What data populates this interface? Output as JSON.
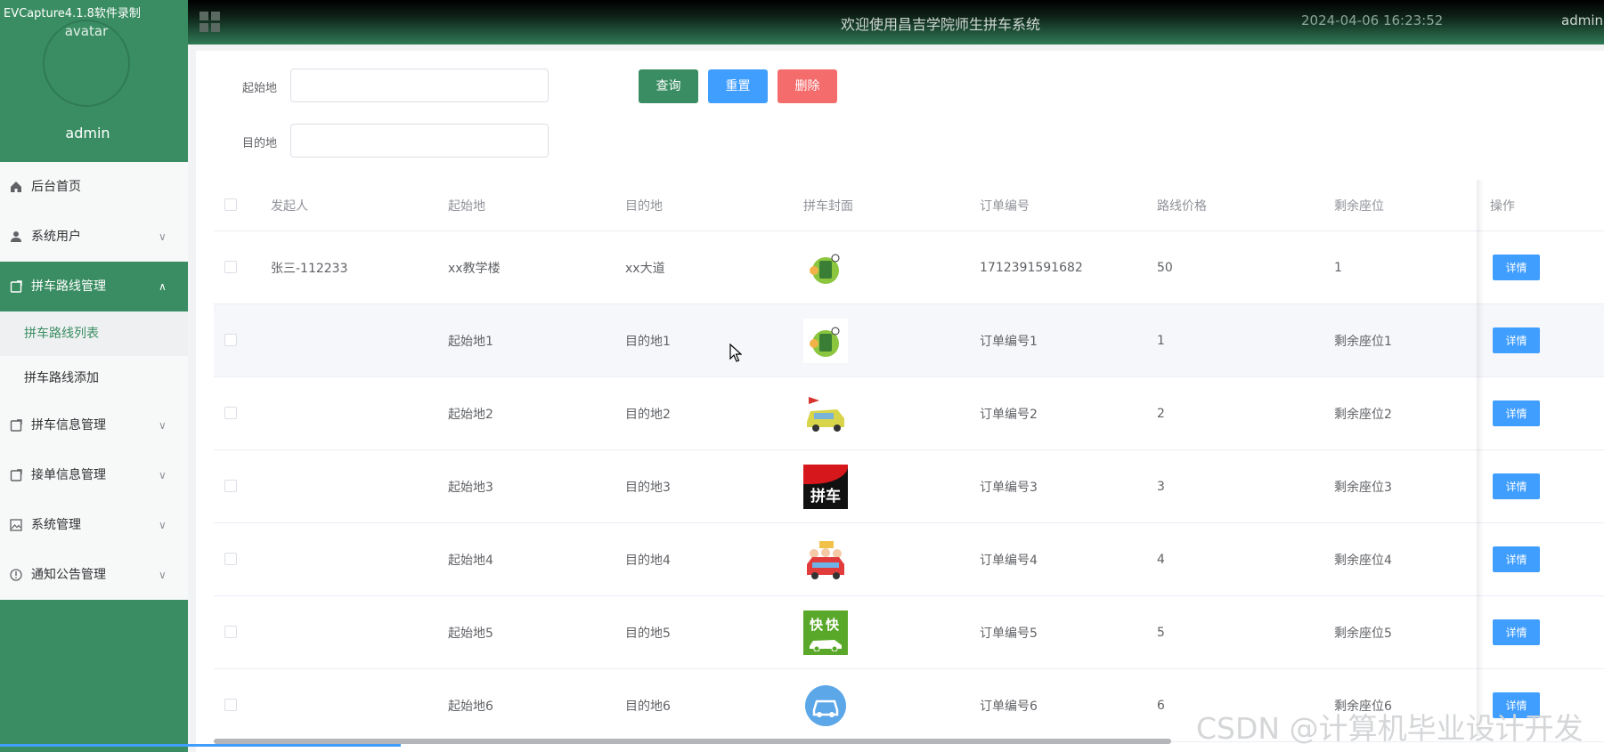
{
  "capture_label": "EVCapture4.1.8软件录制",
  "header": {
    "title": "欢迎使用昌吉学院师生拼车系统",
    "datetime": "2024-04-06 16:23:52",
    "user": "admin"
  },
  "sidebar": {
    "avatar_text": "avatar",
    "username": "admin",
    "menu": [
      {
        "label": "后台首页",
        "icon": "home-icon"
      },
      {
        "label": "系统用户",
        "icon": "user-icon",
        "arrow": "∨"
      },
      {
        "label": "拼车路线管理",
        "icon": "doc-icon",
        "arrow": "∧"
      },
      {
        "label": "拼车信息管理",
        "icon": "doc-icon",
        "arrow": "∨"
      },
      {
        "label": "接单信息管理",
        "icon": "doc-icon",
        "arrow": "∨"
      },
      {
        "label": "系统管理",
        "icon": "image-icon",
        "arrow": "∨"
      },
      {
        "label": "通知公告管理",
        "icon": "info-icon",
        "arrow": "∨"
      }
    ],
    "submenu": [
      "拼车路线列表",
      "拼车路线添加"
    ]
  },
  "search": {
    "start_label": "起始地",
    "start_value": "",
    "dest_label": "目的地",
    "dest_value": "",
    "query_label": "查询",
    "reset_label": "重置",
    "delete_label": "删除"
  },
  "table": {
    "headers": [
      "发起人",
      "起始地",
      "目的地",
      "拼车封面",
      "订单编号",
      "路线价格",
      "剩余座位",
      "操作"
    ],
    "rows": [
      {
        "initiator": "张三-112233",
        "start": "xx教学楼",
        "dest": "xx大道",
        "cover": "carpool-phone-icon",
        "order": "1712391591682",
        "price": "50",
        "seats": "1",
        "action": "详情"
      },
      {
        "initiator": "",
        "start": "起始地1",
        "dest": "目的地1",
        "cover": "carpool-phone-icon",
        "order": "订单编号1",
        "price": "1",
        "seats": "剩余座位1",
        "action": "详情"
      },
      {
        "initiator": "",
        "start": "起始地2",
        "dest": "目的地2",
        "cover": "cartoon-car-icon",
        "order": "订单编号2",
        "price": "2",
        "seats": "剩余座位2",
        "action": "详情"
      },
      {
        "initiator": "",
        "start": "起始地3",
        "dest": "目的地3",
        "cover": "pinche-logo-icon",
        "cover_text": "拼车",
        "order": "订单编号3",
        "price": "3",
        "seats": "剩余座位3",
        "action": "详情"
      },
      {
        "initiator": "",
        "start": "起始地4",
        "dest": "目的地4",
        "cover": "family-car-icon",
        "order": "订单编号4",
        "price": "4",
        "seats": "剩余座位4",
        "action": "详情"
      },
      {
        "initiator": "",
        "start": "起始地5",
        "dest": "目的地5",
        "cover": "kuaikuai-logo-icon",
        "cover_text": "快快",
        "order": "订单编号5",
        "price": "5",
        "seats": "剩余座位5",
        "action": "详情"
      },
      {
        "initiator": "",
        "start": "起始地6",
        "dest": "目的地6",
        "cover": "blue-car-circle-icon",
        "order": "订单编号6",
        "price": "6",
        "seats": "剩余座位6",
        "action": "详情"
      }
    ]
  },
  "watermark": "CSDN @计算机毕业设计开发",
  "colors": {
    "primary": "#3a8d62",
    "query": "#3a8d62",
    "reset": "#409eff",
    "delete": "#f56c6c",
    "detail": "#409eff"
  }
}
